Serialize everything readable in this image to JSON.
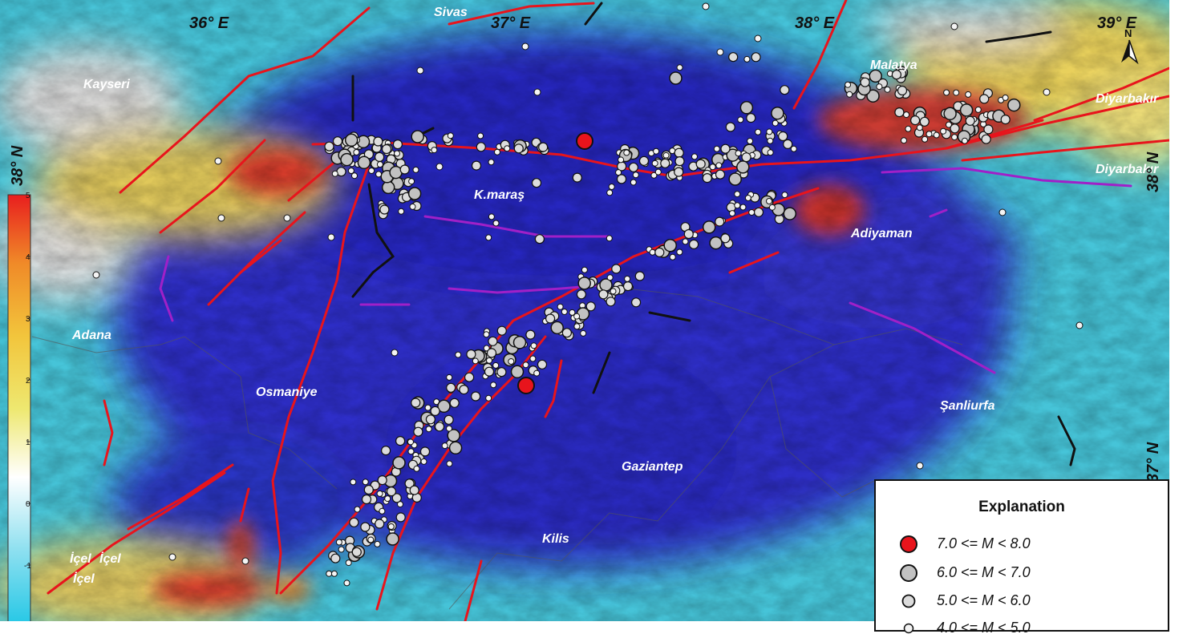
{
  "map": {
    "graticule": {
      "longitudes": [
        "36° E",
        "37° E",
        "38° E",
        "39° E"
      ],
      "latitudes": [
        "38° N",
        "37° N"
      ]
    },
    "places": [
      "Sivas",
      "Kayseri",
      "Malatya",
      "Diyarbakır",
      "Diyarbakır",
      "K.maraş",
      "Adiyaman",
      "Adana",
      "Osmaniye",
      "Şanliurfa",
      "Gaziantep",
      "Kilis",
      "İçel",
      "İçel",
      "İçel"
    ],
    "mainshocks": [
      {
        "lon": 37.2,
        "lat": 38.01,
        "magnitude_class": "7.0 <= M < 8.0"
      },
      {
        "lon": 37.03,
        "lat": 37.22,
        "magnitude_class": "7.0 <= M < 8.0"
      }
    ],
    "fault_colors": {
      "primary": "#e8141c",
      "secondary": "#a020c8",
      "other": "#111111"
    }
  },
  "colorbar": {
    "ticks": [
      "5",
      "4",
      "3",
      "2",
      "1",
      "0",
      "-1"
    ],
    "colors": [
      "#e81e1e",
      "#f08a28",
      "#f2c53c",
      "#eee870",
      "#ffffff",
      "#8ee0f0",
      "#28c8e6"
    ]
  },
  "legend": {
    "title": "Explanation",
    "items": [
      {
        "label": "7.0 <= M < 8.0",
        "fill": "#e8141c"
      },
      {
        "label": "6.0 <= M < 7.0",
        "fill": "#c2c2c2"
      },
      {
        "label": "5.0 <= M < 6.0",
        "fill": "#dcdcdc"
      },
      {
        "label": "4.0 <= M < 5.0",
        "fill": "#f4f4f4"
      }
    ]
  },
  "north_arrow": {
    "label": "N"
  }
}
